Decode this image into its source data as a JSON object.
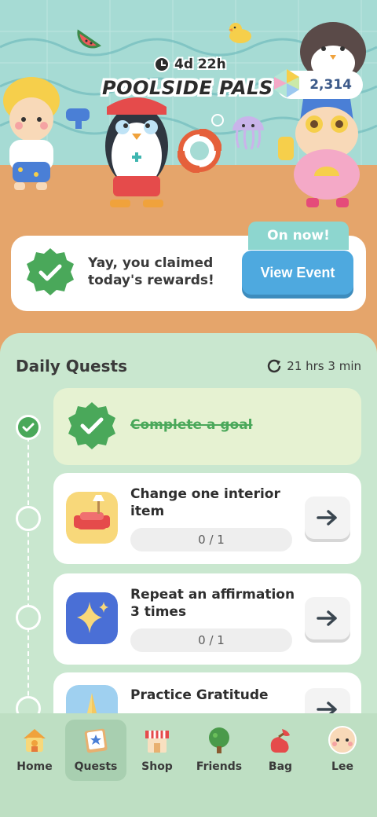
{
  "event": {
    "timer": "4d 22h",
    "title": "POOLSIDE PALS",
    "gems": "2,314"
  },
  "claim": {
    "message_line1": "Yay, you claimed",
    "message_line2": "today's rewards!",
    "on_now": "On now!",
    "view_event": "View Event"
  },
  "daily_quests": {
    "title": "Daily Quests",
    "reset_timer": "21 hrs 3 min",
    "quests": [
      {
        "title": "Complete a goal",
        "completed": true
      },
      {
        "title_line1": "Change one interior",
        "title_line2": "item",
        "progress": "0 / 1",
        "icon": "sofa-icon"
      },
      {
        "title_line1": "Repeat an affirmation",
        "title_line2": "3 times",
        "progress": "0 / 1",
        "icon": "sparkle-icon"
      },
      {
        "title_line1": "Practice Gratitude",
        "icon": "praying-hands-icon"
      }
    ]
  },
  "nav": {
    "items": [
      {
        "label": "Home",
        "icon": "home-icon"
      },
      {
        "label": "Quests",
        "icon": "quests-icon"
      },
      {
        "label": "Shop",
        "icon": "shop-icon"
      },
      {
        "label": "Friends",
        "icon": "friends-icon"
      },
      {
        "label": "Bag",
        "icon": "bag-icon"
      },
      {
        "label": "Lee",
        "icon": "avatar-icon"
      }
    ],
    "active": "Quests"
  },
  "colors": {
    "accent_green": "#4aa85a",
    "accent_blue": "#4ea9df",
    "panel": "#c9e7cf"
  }
}
